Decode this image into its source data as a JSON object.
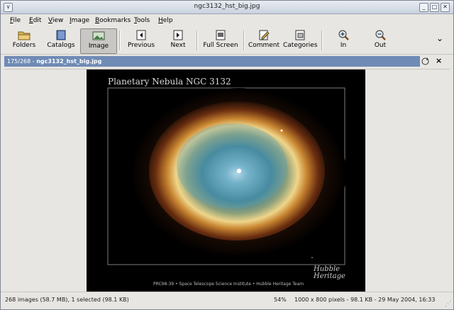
{
  "window": {
    "title": "ngc3132_hst_big.jpg",
    "menu_glyph": "∨",
    "minimize_glyph": "_",
    "maximize_glyph": "□",
    "close_glyph": "✕"
  },
  "menubar": [
    {
      "pre": "",
      "accel": "F",
      "post": "ile"
    },
    {
      "pre": "",
      "accel": "E",
      "post": "dit"
    },
    {
      "pre": "",
      "accel": "V",
      "post": "iew"
    },
    {
      "pre": "",
      "accel": "I",
      "post": "mage"
    },
    {
      "pre": "",
      "accel": "B",
      "post": "ookmarks"
    },
    {
      "pre": "",
      "accel": "T",
      "post": "ools"
    },
    {
      "pre": "",
      "accel": "H",
      "post": "elp"
    }
  ],
  "toolbar": {
    "folders": "Folders",
    "catalogs": "Catalogs",
    "image": "Image",
    "previous": "Previous",
    "next": "Next",
    "full_screen": "Full Screen",
    "comment": "Comment",
    "categories": "Categories",
    "zoom_in": "In",
    "zoom_out": "Out",
    "overflow_glyph": "⌄"
  },
  "pathbar": {
    "position": "175/268",
    "filename": "ngc3132_hst_big.jpg"
  },
  "photo": {
    "title": "Planetary Nebula NGC 3132",
    "credit": "PRC98-39 • Space Telescope Science Institute • Hubble Heritage Team",
    "logo_line1": "Hubble",
    "logo_line2": "Heritage"
  },
  "status": {
    "summary": "268 images (58.7 MB), 1 selected (98.1 KB)",
    "zoom": "54%",
    "info": "1000 x 800 pixels - 98.1 KB - 29 May 2004, 16:33"
  }
}
